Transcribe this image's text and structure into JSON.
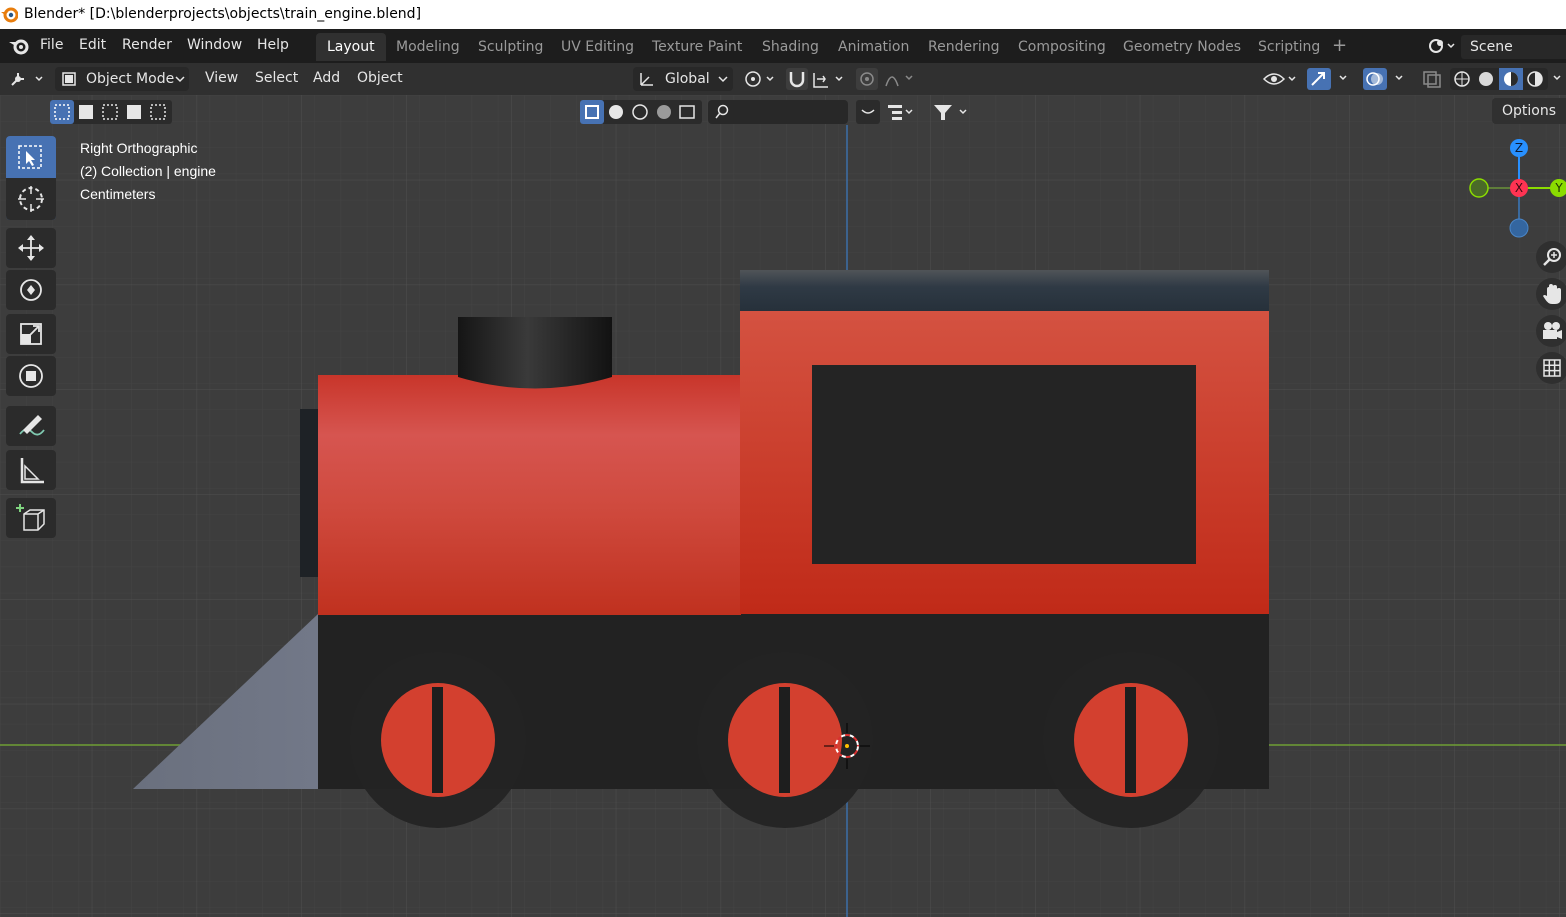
{
  "window": {
    "title": "Blender* [D:\\blenderprojects\\objects\\train_engine.blend]"
  },
  "topbar": {
    "menus": [
      "File",
      "Edit",
      "Render",
      "Window",
      "Help"
    ],
    "workspaces": [
      "Layout",
      "Modeling",
      "Sculpting",
      "UV Editing",
      "Texture Paint",
      "Shading",
      "Animation",
      "Rendering",
      "Compositing",
      "Geometry Nodes",
      "Scripting"
    ],
    "active_workspace": "Layout",
    "add_workspace_label": "+",
    "scene_name": "Scene"
  },
  "viewport_header": {
    "mode": "Object Mode",
    "menus": [
      "View",
      "Select",
      "Add",
      "Object"
    ],
    "transform_orientation": "Global",
    "options_label": "Options"
  },
  "viewport": {
    "view_name": "Right Orthographic",
    "collection_info": "(2) Collection | engine",
    "units": "Centimeters"
  },
  "gizmo": {
    "axes": [
      "Z",
      "X",
      "Y"
    ],
    "colors": {
      "x": "#ff3352",
      "y": "#8bdc00",
      "z": "#2890ff"
    }
  },
  "colors": {
    "accent": "#4772b3",
    "train_red": "#d3402f",
    "train_dark": "#232323",
    "cowcatcher": "#6e7482"
  },
  "icons": {
    "toolbar": [
      "select-box-icon",
      "cursor-icon",
      "move-icon",
      "rotate-icon",
      "scale-icon",
      "transform-icon",
      "annotate-icon",
      "measure-icon",
      "add-cube-icon"
    ],
    "navigation": [
      "zoom-icon",
      "hand-pan-icon",
      "camera-icon",
      "grid-icon"
    ]
  }
}
